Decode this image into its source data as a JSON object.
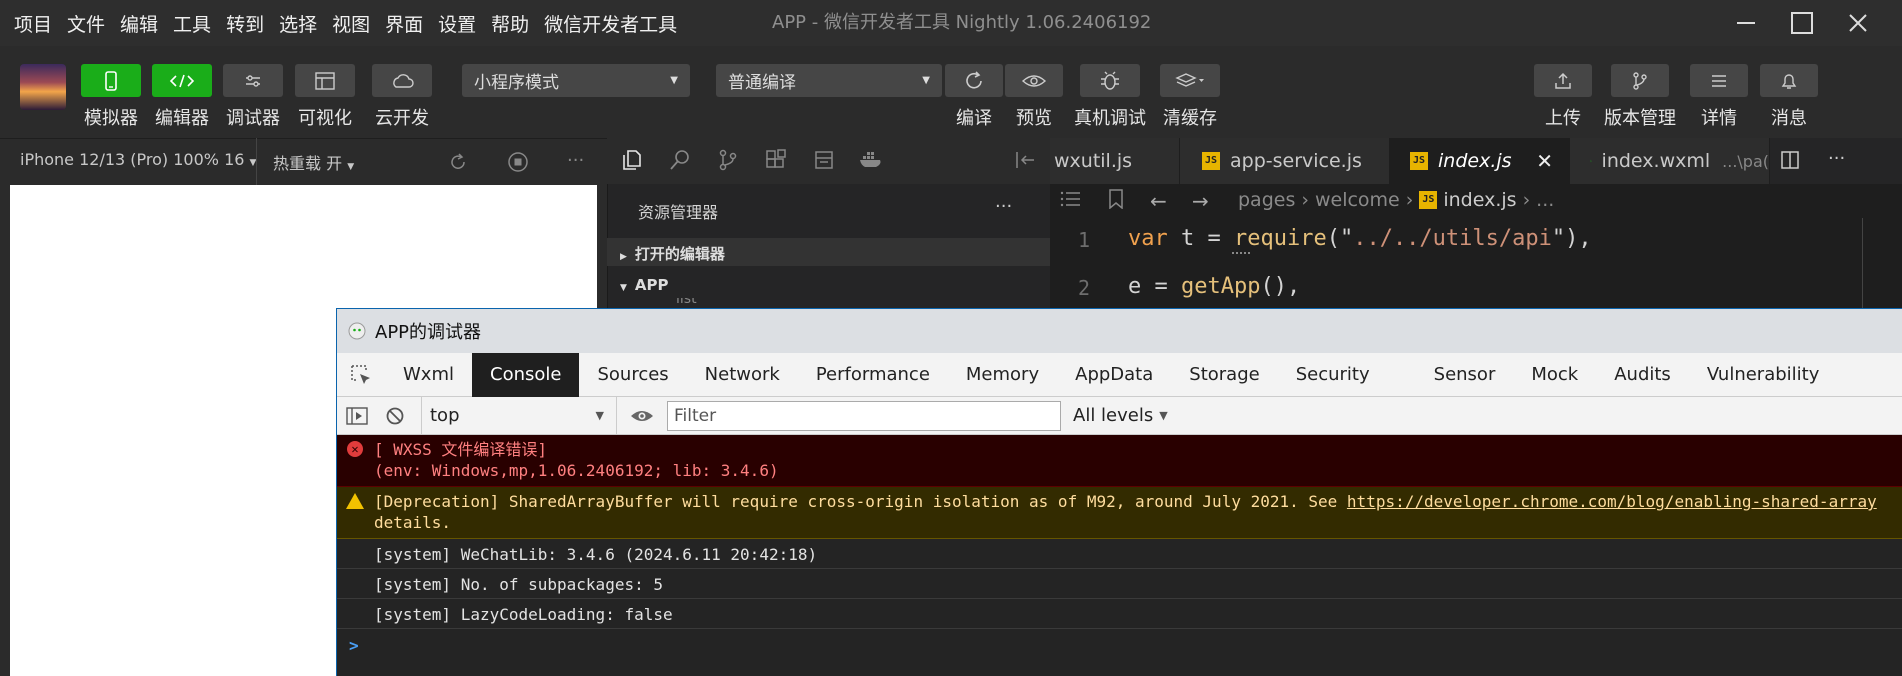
{
  "menubar": {
    "items": [
      "项目",
      "文件",
      "编辑",
      "工具",
      "转到",
      "选择",
      "视图",
      "界面",
      "设置",
      "帮助",
      "微信开发者工具"
    ],
    "window_title": "APP - 微信开发者工具 Nightly 1.06.2406192"
  },
  "toolbar": {
    "simulator_label": "模拟器",
    "editor_label": "编辑器",
    "debugger_label": "调试器",
    "visual_label": "可视化",
    "cloud_label": "云开发",
    "mode_select": "小程序模式",
    "compile_select": "普通编译",
    "compile_label": "编译",
    "preview_label": "预览",
    "realdevice_label": "真机调试",
    "clearcache_label": "清缓存",
    "upload_label": "上传",
    "version_label": "版本管理",
    "details_label": "详情",
    "messages_label": "消息"
  },
  "simulator": {
    "device_label": "iPhone 12/13 (Pro) 100% 16",
    "hotreload_label": "热重载 开"
  },
  "explorer": {
    "title": "资源管理器",
    "more": "···",
    "open_editors": "打开的编辑器",
    "project_root": "APP",
    "partial_item": "list"
  },
  "editor": {
    "tabs": [
      {
        "label": "wxutil.js"
      },
      {
        "label": "app-service.js"
      },
      {
        "label": "index.js"
      },
      {
        "label": "index.wxml",
        "hint": "...\\pa("
      }
    ],
    "breadcrumb": [
      "pages",
      "welcome",
      "index.js",
      "..."
    ],
    "js_badge": "JS",
    "line_numbers": [
      "1",
      "2"
    ],
    "line1": {
      "kw": "var",
      "plain1": " t = ",
      "fn": "require",
      "punc1": "(\"",
      "str": "../../utils/api",
      "punc2": "\"),"
    },
    "line2": {
      "plain1": "e = ",
      "fn": "getApp",
      "punc": "(),"
    }
  },
  "debugger": {
    "title": "APP的调试器",
    "tabs": [
      "Wxml",
      "Console",
      "Sources",
      "Network",
      "Performance",
      "Memory",
      "AppData",
      "Storage",
      "Security",
      "Sensor",
      "Mock",
      "Audits",
      "Vulnerability"
    ],
    "active_tab": "Console",
    "context_select": "top",
    "filter_placeholder": "Filter",
    "levels_select": "All levels",
    "console": {
      "error_line1": "[ WXSS 文件编译错误]",
      "error_line2": "(env: Windows,mp,1.06.2406192; lib: 3.4.6)",
      "warn_text": "[Deprecation] SharedArrayBuffer will require cross-origin isolation as of M92, around July 2021. See ",
      "warn_link": "https://developer.chrome.com/blog/enabling-shared-array",
      "warn_line2": "details.",
      "log1": "[system] WeChatLib: 3.4.6 (2024.6.11 20:42:18)",
      "log2": "[system] No. of subpackages: 5",
      "log3": "[system] LazyCodeLoading: false",
      "prompt": ">"
    }
  },
  "colors": {
    "accent_green": "#1aad19",
    "error_red": "#ff8080",
    "warning_yellow": "#ffdd9e",
    "keyword_orange": "#f0a14e",
    "string_orange": "#ce9178",
    "function_yellow": "#e5c07b"
  }
}
